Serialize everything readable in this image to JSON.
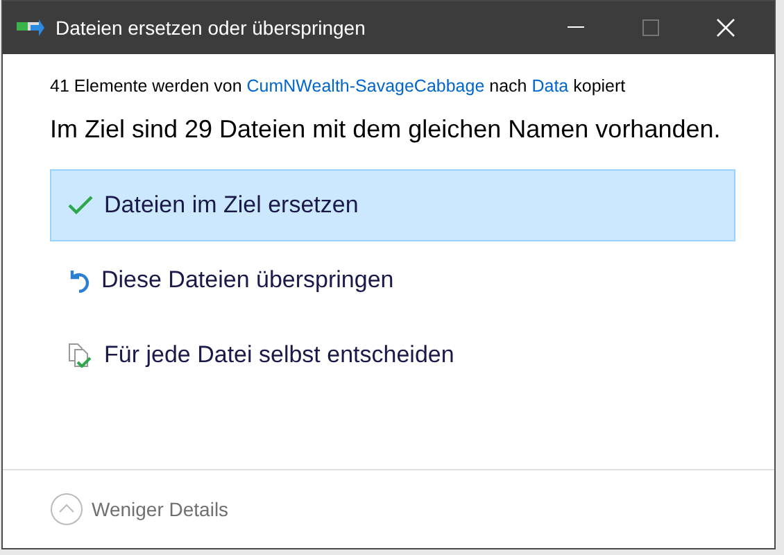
{
  "window": {
    "title": "Dateien ersetzen oder überspringen"
  },
  "summary": [
    {
      "kind": "text",
      "text": "41 Elemente werden von "
    },
    {
      "kind": "link",
      "text": "CumNWealth-SavageCabbage"
    },
    {
      "kind": "text",
      "text": " nach "
    },
    {
      "kind": "link",
      "text": "Data"
    },
    {
      "kind": "text",
      "text": " kopiert"
    }
  ],
  "heading": "Im Ziel sind 29 Dateien mit dem gleichen Namen vorhanden.",
  "options": [
    {
      "kind": "replace",
      "label": "Dateien im Ziel ersetzen",
      "selected": true
    },
    {
      "kind": "skip",
      "label": "Diese Dateien überspringen",
      "selected": false
    },
    {
      "kind": "decide",
      "label": "Für jede Datei selbst entscheiden",
      "selected": false
    }
  ],
  "footer": {
    "label": "Weniger Details"
  }
}
